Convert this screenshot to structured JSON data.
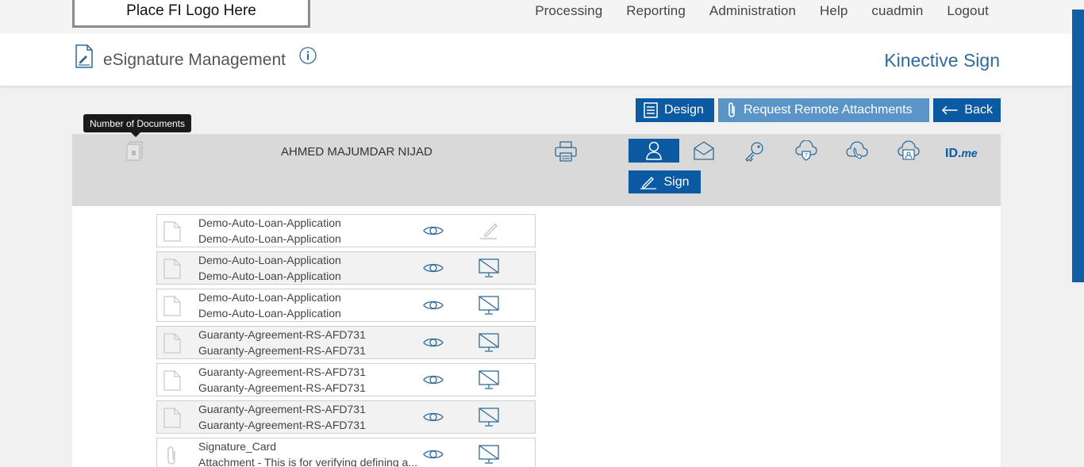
{
  "topbar": {
    "logo_text": "Place FI Logo Here",
    "nav": [
      "Processing",
      "Reporting",
      "Administration",
      "Help",
      "cuadmin",
      "Logout"
    ]
  },
  "header": {
    "title": "eSignature Management",
    "brand": "Kinective Sign"
  },
  "actions": {
    "design": "Design",
    "remote": "Request Remote Attachments",
    "back": "Back"
  },
  "tooltip": "Number of Documents",
  "signer": {
    "name": "AHMED MAJUMDAR NIJAD",
    "idme_main": "ID.",
    "idme_suffix": "me",
    "sign_label": "Sign"
  },
  "documents": [
    {
      "line1": "Demo-Auto-Loan-Application",
      "line2": "Demo-Auto-Loan-Application",
      "type": "file",
      "action": "sign-pen"
    },
    {
      "line1": "Demo-Auto-Loan-Application",
      "line2": "Demo-Auto-Loan-Application",
      "type": "file",
      "action": "screen"
    },
    {
      "line1": "Demo-Auto-Loan-Application",
      "line2": "Demo-Auto-Loan-Application",
      "type": "file",
      "action": "screen"
    },
    {
      "line1": "Guaranty-Agreement-RS-AFD731",
      "line2": "Guaranty-Agreement-RS-AFD731",
      "type": "file",
      "action": "screen"
    },
    {
      "line1": "Guaranty-Agreement-RS-AFD731",
      "line2": "Guaranty-Agreement-RS-AFD731",
      "type": "file",
      "action": "screen"
    },
    {
      "line1": "Guaranty-Agreement-RS-AFD731",
      "line2": "Guaranty-Agreement-RS-AFD731",
      "type": "file",
      "action": "screen"
    },
    {
      "line1": "Signature_Card",
      "line2": "Attachment - This is for verifying defining a...",
      "type": "attachment",
      "action": "screen"
    }
  ]
}
